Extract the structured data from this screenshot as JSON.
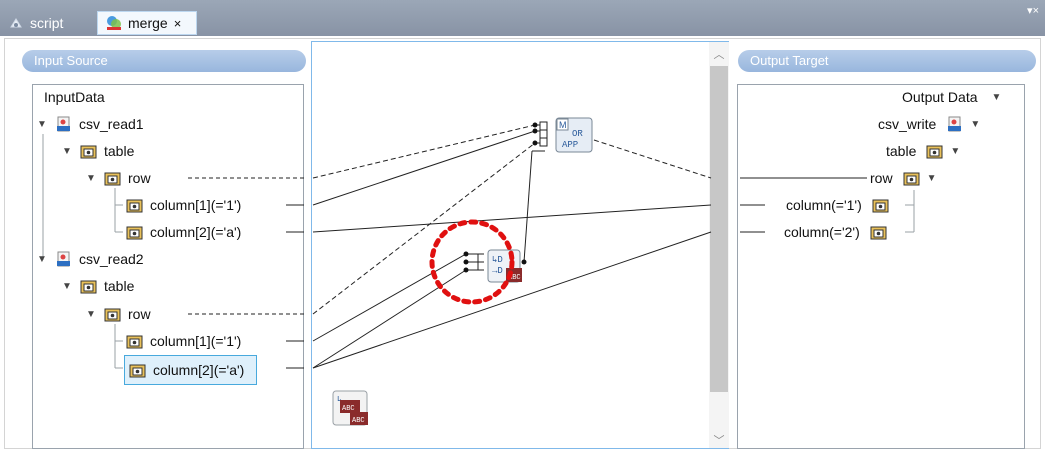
{
  "tabs": [
    {
      "label": "script",
      "icon": "script-icon"
    },
    {
      "label": "merge",
      "icon": "merge-icon",
      "close": "×"
    }
  ],
  "menu_arrow": "▾×",
  "input_panel": {
    "header": "Input Source",
    "root": "InputData",
    "nodes": {
      "csv_read1": "csv_read1",
      "table1": "table",
      "row1": "row",
      "col1_1": "column[1](='1')",
      "col1_2": "column[2](='a')",
      "csv_read2": "csv_read2",
      "table2": "table",
      "row2": "row",
      "col2_1": "column[1](='1')",
      "col2_2": "column[2](='a')"
    }
  },
  "output_panel": {
    "header": "Output Target",
    "root": "Output Data",
    "nodes": {
      "csv_write": "csv_write",
      "table": "table",
      "row": "row",
      "col1": "column(='1')",
      "col2": "column(='2')"
    }
  },
  "mapping": {
    "or_app_icon": {
      "label": "OR\nAPP"
    },
    "highlight_color": "#e01010",
    "wire_color": "#222222"
  },
  "colors": {
    "tabbar": "#8f9aab",
    "panel_header": "#a6c1e3",
    "selection": "#dff0fb",
    "selection_border": "#48a9dd",
    "center_border": "#80b9ea"
  }
}
